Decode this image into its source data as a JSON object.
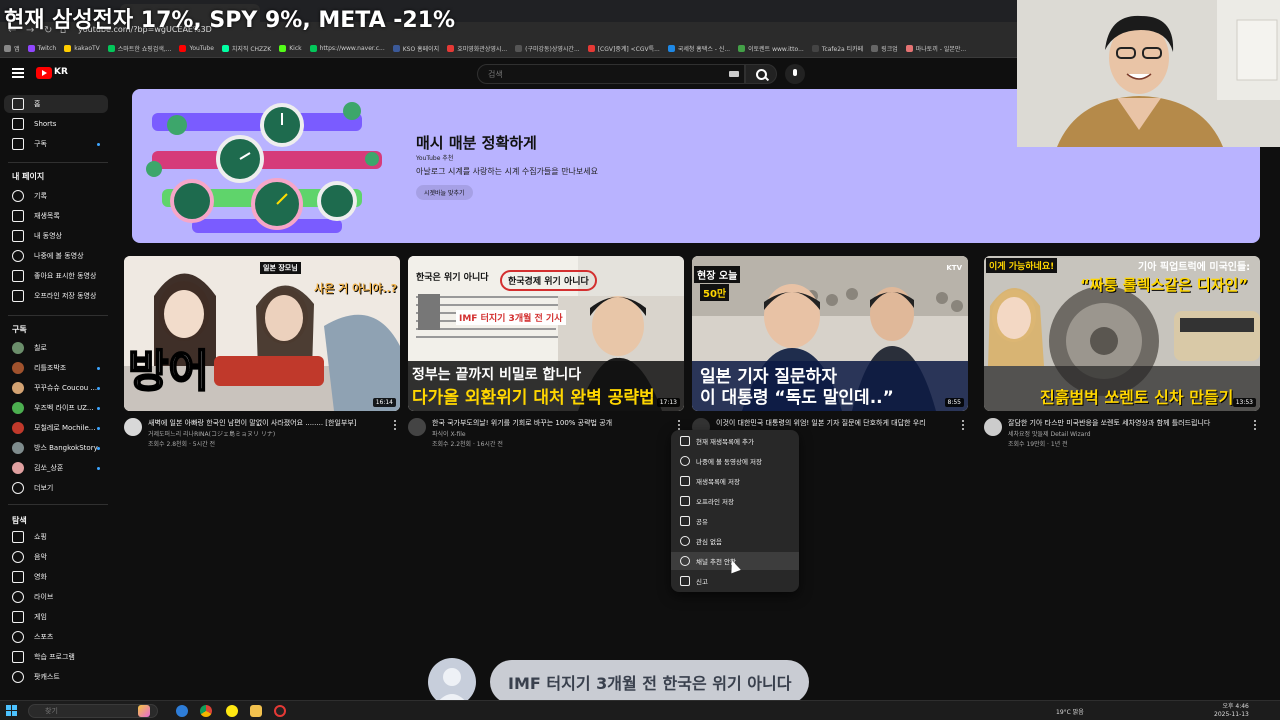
{
  "overlay_title": "현재 삼성전자 17%, SPY 9%, META -21%",
  "browser": {
    "url": "youtube.com/?bp=wgUCEAE%3D",
    "bookmarks": [
      {
        "label": "앱",
        "color": "#888888"
      },
      {
        "label": "Twitch",
        "color": "#9146ff"
      },
      {
        "label": "kakaoTV",
        "color": "#ffcd00"
      },
      {
        "label": "스마트한 쇼핑검색,...",
        "color": "#03c75a"
      },
      {
        "label": "YouTube",
        "color": "#ff0000"
      },
      {
        "label": "치지직 CHZZK",
        "color": "#00ffa3"
      },
      {
        "label": "Kick",
        "color": "#53fc18"
      },
      {
        "label": "https://www.naver.c...",
        "color": "#03c75a"
      },
      {
        "label": "KSO 홈페이지",
        "color": "#3b5998"
      },
      {
        "label": "호미영화관상영시...",
        "color": "#e53935"
      },
      {
        "label": "(구미강동)상영시간...",
        "color": "#555555"
      },
      {
        "label": "[CGV]중계] <CGV특...",
        "color": "#e53935"
      },
      {
        "label": "국세청 홈택스 - 신...",
        "color": "#1e88e5"
      },
      {
        "label": "이토렌트 www.itto...",
        "color": "#43a047"
      },
      {
        "label": "Tcafe2a 티카페",
        "color": "#444444"
      },
      {
        "label": "링크업",
        "color": "#666666"
      },
      {
        "label": "마나토끼 - 일본만...",
        "color": "#e57373"
      }
    ]
  },
  "youtube": {
    "logo_text": "KR",
    "search_placeholder": "검색",
    "sidebar": {
      "main": [
        {
          "label": "홈",
          "icon": "home-icon",
          "active": true
        },
        {
          "label": "Shorts",
          "icon": "shorts-icon"
        },
        {
          "label": "구독",
          "icon": "subscriptions-icon",
          "dot": true
        }
      ],
      "mypage_title": "내 페이지",
      "mypage": [
        {
          "label": "기록",
          "icon": "history-icon"
        },
        {
          "label": "재생목록",
          "icon": "playlist-icon"
        },
        {
          "label": "내 동영상",
          "icon": "my-videos-icon"
        },
        {
          "label": "나중에 볼 동영상",
          "icon": "watch-later-icon"
        },
        {
          "label": "좋아요 표시한 동영상",
          "icon": "like-icon"
        },
        {
          "label": "오프라인 저장 동영상",
          "icon": "download-icon"
        }
      ],
      "subs_title": "구독",
      "subs": [
        {
          "label": "칠로",
          "color": "#6b8e6b",
          "dot": false
        },
        {
          "label": "리틀조박조",
          "color": "#a0522d",
          "dot": true
        },
        {
          "label": "꾸꾸슈슈 Coucou ...",
          "color": "#d4a373",
          "dot": true
        },
        {
          "label": "우즈벡 라이프 UZ...",
          "color": "#4caf50",
          "dot": true
        },
        {
          "label": "모칠레로 Mochile...",
          "color": "#c0392b",
          "dot": true
        },
        {
          "label": "방스 BangkokStory",
          "color": "#7f8c8d",
          "dot": true
        },
        {
          "label": "김쏘_상훈",
          "color": "#e0a0a0",
          "dot": true
        }
      ],
      "more_label": "더보기",
      "explore_title": "탐색",
      "explore": [
        {
          "label": "쇼핑",
          "icon": "shopping-icon"
        },
        {
          "label": "음악",
          "icon": "music-icon"
        },
        {
          "label": "영화",
          "icon": "movie-icon"
        },
        {
          "label": "라이브",
          "icon": "live-icon"
        },
        {
          "label": "게임",
          "icon": "gaming-icon"
        },
        {
          "label": "스포츠",
          "icon": "sports-icon"
        },
        {
          "label": "학습 프로그램",
          "icon": "learning-icon"
        },
        {
          "label": "팟캐스트",
          "icon": "podcast-icon"
        }
      ]
    },
    "banner": {
      "title": "매시 매분 정확하게",
      "subtitle": "YouTube 추천",
      "description": "아날로그 시계를 사랑하는 시계 수집가들을 만나보세요",
      "button": "시곗바늘 맞추기"
    },
    "videos": [
      {
        "title": "새벽에 일본 아빠랑 한국인 남편이 말없이 사라졌어요 ........ [한일부부]",
        "channel": "거제도퍼느리 리나RINA(コジェ島ミョヌリ リナ)",
        "meta": "조회수 2.8천회 · 5시간 전",
        "duration": "16:14",
        "thumb_tag": "일본 장모님",
        "thumb_sub": "사온 거 아니야..?",
        "thumb_big": "방어",
        "avatar_color": "#d8d8d8"
      },
      {
        "title": "한국 국가부도의날! 위기를 기회로 바꾸는 100% 공략법 공개",
        "channel": "파식이 X-file",
        "meta": "조회수 2.2천회 · 16시간 전",
        "duration": "17:13",
        "thumb_paper1": "한국은 위기 아니다",
        "thumb_paper2": "한국경제 위기 아니다",
        "thumb_mid": "IMF 터지기 3개월 전 기사",
        "thumb_line1": "정부는 끝까지 비밀로 합니다",
        "thumb_line2": "다가올 외환위기 대처 완벽 공략법",
        "avatar_color": "#444444"
      },
      {
        "title": "이것이 대한민국 대통령의 위엄! 일본 기자 질문에 단호하게 대답한 우리",
        "channel": "",
        "meta": "",
        "duration": "8:55",
        "thumb_tag": "현장 오늘",
        "thumb_num": "50만",
        "thumb_corner": "KTV",
        "thumb_line1": "일본 기자 질문하자",
        "thumb_line2": "이 대통령 “독도 말인데..”",
        "avatar_color": "#333333"
      },
      {
        "title": "잘담한 기아 타스만 미국반응을 쏘렌토 세차영상과 함께 틀러드립니다",
        "channel": "세차요정 맛들제 Detail Wizard",
        "meta": "조회수 19만회 · 1년 전",
        "duration": "13:53",
        "thumb_tag": "이게 가능하네요!",
        "thumb_top": "기아 픽업트럭에 미국인들:",
        "thumb_quote": "“짜퉁 롤렉스같은 디자인”",
        "thumb_bottom": "진흙범벅 쏘렌토 신차 만들기",
        "avatar_color": "#cccccc"
      }
    ],
    "menu": [
      {
        "label": "현재 재생목록에 추가",
        "icon": "queue-icon"
      },
      {
        "label": "나중에 볼 동영상에 저장",
        "icon": "clock-icon"
      },
      {
        "label": "재생목록에 저장",
        "icon": "bookmark-icon"
      },
      {
        "label": "오프라인 저장",
        "icon": "download-icon"
      },
      {
        "label": "공유",
        "icon": "share-icon"
      },
      {
        "label": "관심 없음",
        "icon": "block-icon"
      },
      {
        "label": "채널 추천 안함",
        "icon": "minus-circle-icon"
      },
      {
        "label": "신고",
        "icon": "flag-icon"
      }
    ]
  },
  "subtitle": "IMF 터지기 3개월 전 한국은 위기 아니다",
  "taskbar": {
    "search_placeholder": "찾기",
    "weather": "19°C 맑음",
    "time": "오후 4:46",
    "date": "2025-11-13"
  }
}
